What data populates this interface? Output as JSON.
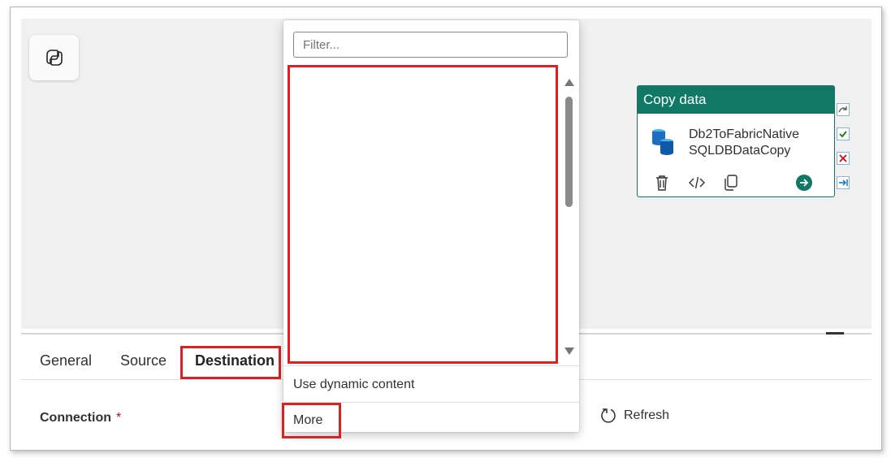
{
  "canvas": {
    "copilot_icon": "copilot-icon",
    "activity": {
      "type_label": "Copy data",
      "name_line1": "Db2ToFabricNative",
      "name_line2": "SQLDBDataCopy",
      "icon": "database-icon",
      "header_color": "#117865",
      "actions": [
        "delete-icon",
        "code-icon",
        "copy-icon",
        "arrow-right-circle-icon"
      ],
      "side_connectors": [
        "skip-connector-icon",
        "success-connector-icon",
        "failure-connector-icon",
        "completion-connector-icon"
      ]
    }
  },
  "dropdown": {
    "filter_placeholder": "Filter...",
    "dynamic_content_label": "Use dynamic content",
    "more_label": "More"
  },
  "tabs": [
    {
      "label": "General"
    },
    {
      "label": "Source"
    },
    {
      "label": "Destination",
      "active": true
    }
  ],
  "destination": {
    "connection_label": "Connection",
    "required_mark": "*",
    "refresh_label": "Refresh"
  },
  "colors": {
    "highlight": "#e02020",
    "accent": "#117865"
  }
}
